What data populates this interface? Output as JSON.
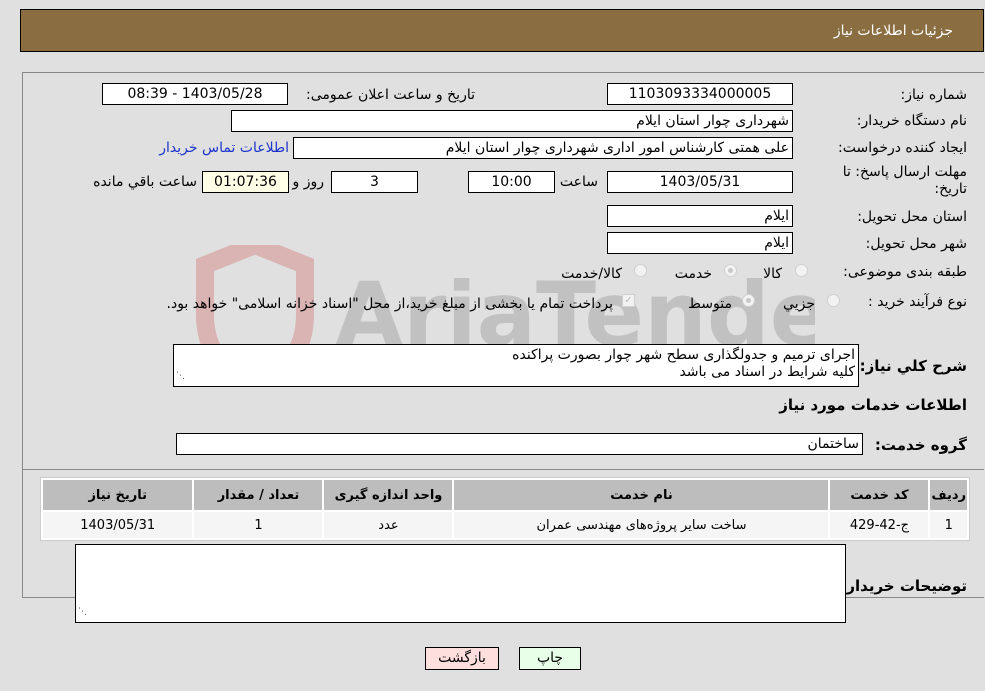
{
  "header": {
    "title": "جزئیات اطلاعات نیاز"
  },
  "fields": {
    "need_number_label": "شماره نیاز:",
    "need_number": "1103093334000005",
    "announce_label": "تاریخ و ساعت اعلان عمومی:",
    "announce_value": "1403/05/28 - 08:39",
    "buyer_org_label": "نام دستگاه خریدار:",
    "buyer_org": "شهرداری چوار استان ایلام",
    "creator_label": "ایجاد کننده درخواست:",
    "creator": "علی  همتی  کارشناس امور اداری  شهرداری چوار استان ایلام",
    "contact_link": "اطلاعات تماس خریدار",
    "deadline_label": "مهلت ارسال پاسخ: تا تاریخ:",
    "deadline_date": "1403/05/31",
    "time_label": "ساعت",
    "deadline_time": "10:00",
    "days": "3",
    "days_label": "روز و",
    "remaining_time": "01:07:36",
    "remaining_label": "ساعت باقي مانده",
    "province_label": "استان محل تحویل:",
    "province": "ایلام",
    "city_label": "شهر محل تحویل:",
    "city": "ایلام",
    "category_label": "طبقه بندی موضوعی:",
    "category_options": [
      "کالا",
      "خدمت",
      "کالا/خدمت"
    ],
    "category_selected": "خدمت",
    "purchase_type_label": "نوع فرآیند خرید :",
    "purchase_type_options": [
      "جزیي",
      "متوسط"
    ],
    "purchase_type_selected": "متوسط",
    "treasury_note": "پرداخت تمام یا بخشی از مبلغ خرید،از محل \"اسناد خزانه اسلامی\" خواهد بود.",
    "description_label": "شرح کلي نياز:",
    "description_line1": "اجرای ترمیم و جدولگذاری سطح شهر چوار بصورت پراکنده",
    "description_line2": "کلیه شرایط در اسناد می باشد",
    "services_heading": "اطلاعات خدمات مورد نیاز",
    "service_group_label": "گروه خدمت:",
    "service_group": "ساختمان",
    "buyer_notes_label": "توضیحات خریدار:",
    "buyer_notes": ""
  },
  "table": {
    "headers": [
      "ردیف",
      "کد خدمت",
      "نام خدمت",
      "واحد اندازه گیری",
      "تعداد / مقدار",
      "تاریخ نیاز"
    ],
    "rows": [
      [
        "1",
        "ج-42-429",
        "ساخت سایر پروژه‌های مهندسی عمران",
        "عدد",
        "1",
        "1403/05/31"
      ]
    ]
  },
  "buttons": {
    "print": "چاپ",
    "back": "بازگشت"
  },
  "watermark": "AriaTender.neT",
  "colors": {
    "header_bg": "#8b6d42",
    "print_bg": "#e8ffe8",
    "back_bg": "#ffdede",
    "link": "#1a33cc"
  }
}
